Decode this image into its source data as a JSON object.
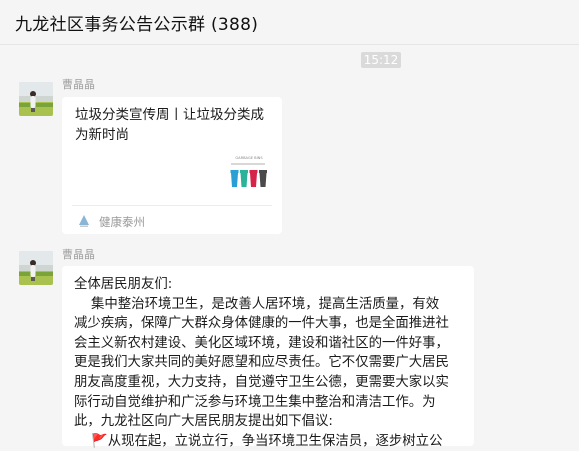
{
  "window": {
    "title": "九龙社区事务公告公示群 (388)"
  },
  "chat": {
    "timestamp": "15:12",
    "messages": [
      {
        "sender": "曹晶晶",
        "type": "link-card",
        "card": {
          "title": "垃圾分类宣传周丨让垃圾分类成为新时尚",
          "source": "健康泰州",
          "thumbnail_label": "GARBAGE BINS",
          "thumbnail_colors": [
            "#2a9fd6",
            "#2bb39a",
            "#d6234a",
            "#4a4a4a"
          ]
        }
      },
      {
        "sender": "曹晶晶",
        "type": "text",
        "lines": [
          "全体居民朋友们:",
          "    集中整治环境卫生，是改善人居环境，提高生活质量，有效",
          "减少疾病，保障广大群众身体健康的一件大事，也是全面推进社",
          "会主义新农村建设、美化区域环境，建设和谐社区的一件好事，",
          "更是我们大家共同的美好愿望和应尽责任。它不仅需要广大居民",
          "朋友高度重视，大力支持，自觉遵守卫生公德，更需要大家以实",
          "际行动自觉维护和广泛参与环境卫生集中整治和清洁工作。为",
          "此，九龙社区向广大居民朋友提出如下倡议:",
          "    🚩从现在起，立说立行，争当环境卫生保洁员，逐步树立公"
        ]
      }
    ]
  }
}
